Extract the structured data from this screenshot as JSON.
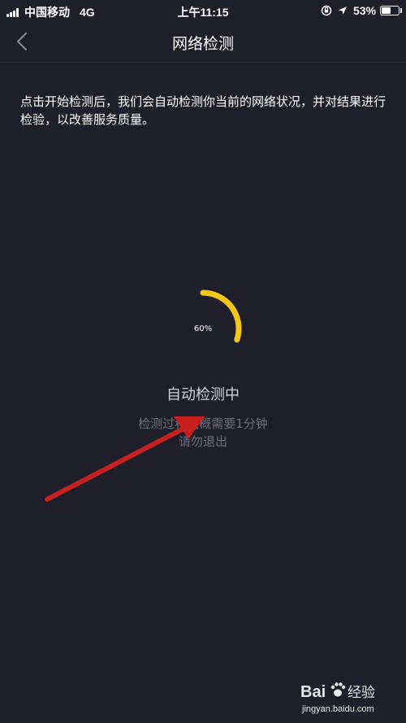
{
  "status_bar": {
    "carrier": "中国移动",
    "network": "4G",
    "time": "上午11:15",
    "battery_percent": "53%",
    "battery_level": 0.53
  },
  "nav": {
    "title": "网络检测",
    "back_icon": "chevron-left-icon"
  },
  "description": "点击开始检测后，我们会自动检测你当前的网络状况，并对结果进行检验，以改善服务质量。",
  "progress": {
    "label": "60%",
    "value": 0.6,
    "color": "#f5c518"
  },
  "detection": {
    "title": "自动检测中",
    "hint_line1": "检测过程大概需要1分钟",
    "hint_line2": "请勿退出"
  },
  "annotation": {
    "arrow_color": "#c8201e"
  },
  "watermark": {
    "brand": "Bai 经验",
    "url": "jingyan.baidu.com"
  }
}
